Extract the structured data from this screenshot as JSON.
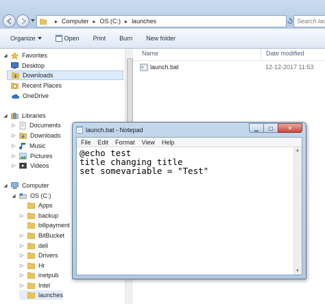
{
  "explorer": {
    "breadcrumbs": [
      "Computer",
      "OS (C:)",
      "launches"
    ],
    "search_placeholder": "Search launches",
    "toolbar": {
      "organize_label": "Organize",
      "open_label": "Open",
      "print_label": "Print",
      "burn_label": "Burn",
      "new_folder_label": "New folder"
    },
    "nav": {
      "favorites_label": "Favorites",
      "favorites": [
        "Desktop",
        "Downloads",
        "Recent Places",
        "OneDrive"
      ],
      "libraries_label": "Libraries",
      "libraries": [
        "Documents",
        "Downloads",
        "Music",
        "Pictures",
        "Videos"
      ],
      "computer_label": "Computer",
      "drive_label": "OS (C:)",
      "folders": [
        "Apps",
        "backup",
        "billpayment",
        "BitBucket",
        "dell",
        "Drivers",
        "Hr",
        "inetpub",
        "Intel",
        "launches"
      ]
    },
    "columns": {
      "name": "Name",
      "date_modified": "Date modified"
    },
    "files": [
      {
        "name": "launch.bat",
        "date": "12-12-2017 11:53"
      }
    ]
  },
  "notepad": {
    "title": "launch.bat - Notepad",
    "menu": [
      "File",
      "Edit",
      "Format",
      "View",
      "Help"
    ],
    "lines": [
      "@echo test",
      "title changing title",
      "set somevariable = \"Test\""
    ]
  },
  "colors": {
    "selection": "#dcebfc",
    "folder": "#e9c35b",
    "chrome": "#c9dbef"
  }
}
